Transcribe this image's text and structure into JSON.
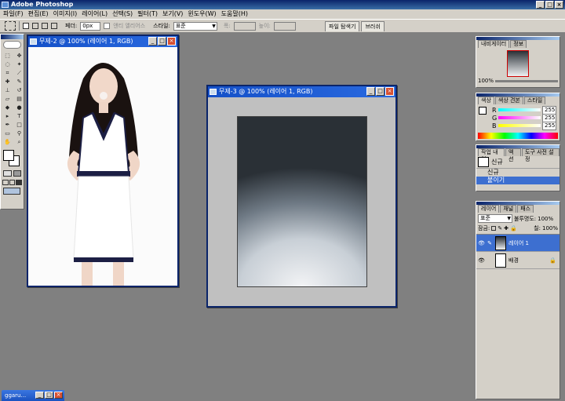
{
  "app": {
    "title": "Adobe Photoshop",
    "controls": [
      "_",
      "□",
      "×"
    ]
  },
  "menu": [
    "파일(F)",
    "편집(E)",
    "이미지(I)",
    "레이어(L)",
    "선택(S)",
    "필터(T)",
    "보기(V)",
    "윈도우(W)",
    "도움말(H)"
  ],
  "options": {
    "feather_label": "페더:",
    "feather_value": "0px",
    "antialias_label": "앤티 앨리어스",
    "style_label": "스타일:",
    "style_value": "표준",
    "width_label": "폭:",
    "height_label": "높이:"
  },
  "dock_tabs": [
    "파일 탐색기",
    "브러쉬"
  ],
  "docs": {
    "doc2_title": "무제-2 @ 100% (레이어 1, RGB)",
    "doc3_title": "무제-3 @ 100% (레이어 1, RGB)"
  },
  "navigator": {
    "tabs": [
      "내비게이터",
      "정보"
    ],
    "zoom": "100%"
  },
  "color": {
    "tabs": [
      "색상",
      "색상 견본",
      "스타일"
    ],
    "channels": [
      {
        "label": "R",
        "value": "255"
      },
      {
        "label": "G",
        "value": "255"
      },
      {
        "label": "B",
        "value": "255"
      }
    ]
  },
  "history": {
    "tabs": [
      "작업 내역",
      "액션",
      "도구 사전 설정"
    ],
    "items": [
      "신규",
      "신규",
      "붙이기"
    ]
  },
  "layers": {
    "tabs": [
      "레이어",
      "채널",
      "패스"
    ],
    "blend_mode": "표준",
    "opacity_label": "불투명도:",
    "opacity_value": "100%",
    "lock_label": "잠금:",
    "fill_label": "칠:",
    "fill_value": "100%",
    "items": [
      {
        "name": "레이어 1",
        "selected": true
      },
      {
        "name": "배경",
        "selected": false
      }
    ]
  },
  "taskbar": {
    "label": "ggaru..."
  },
  "colors": {
    "accent": "#0a246a",
    "selected": "#3d6fd0"
  }
}
